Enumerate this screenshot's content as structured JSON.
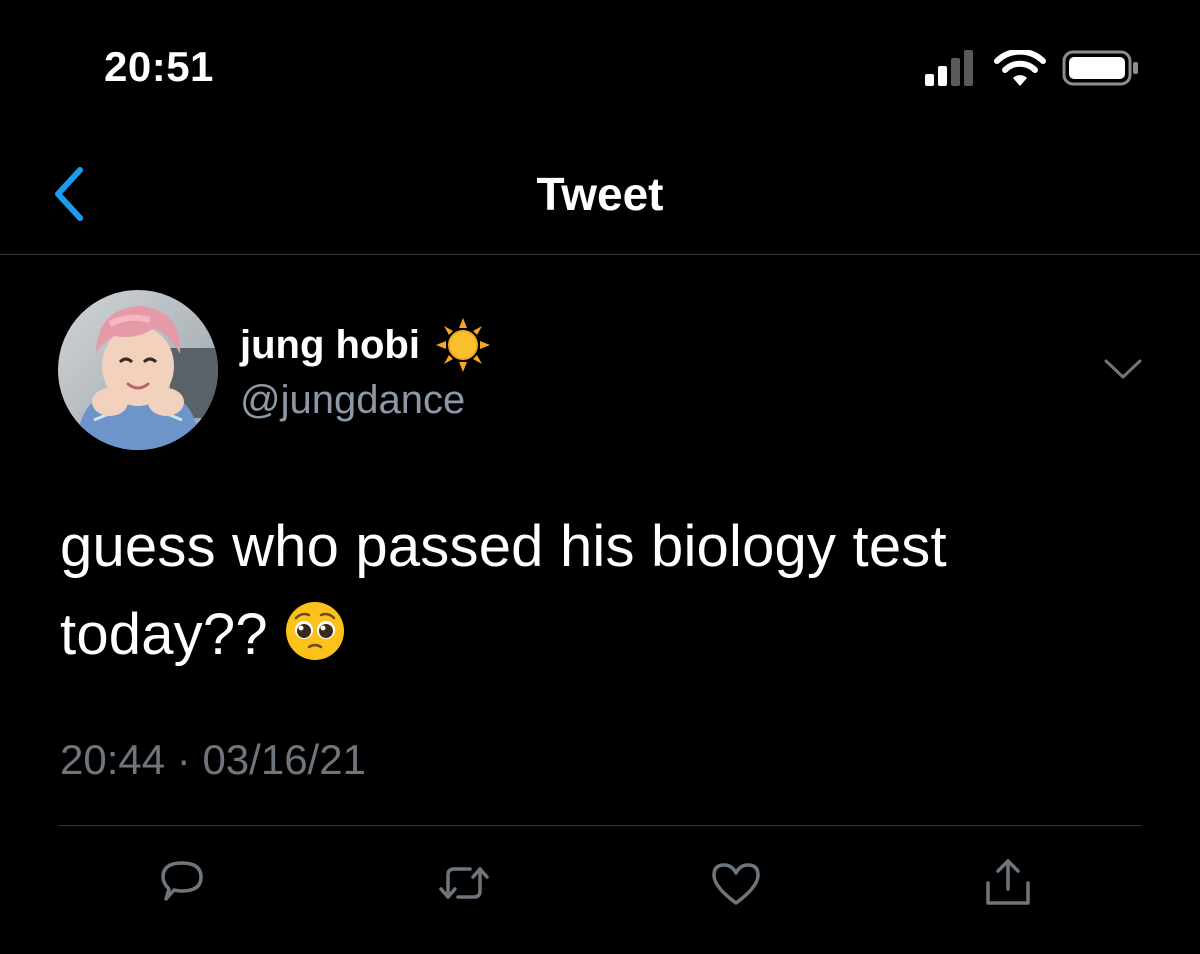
{
  "status_bar": {
    "time": "20:51",
    "icons": [
      "cellular-signal-icon",
      "wifi-icon",
      "battery-icon"
    ]
  },
  "nav": {
    "back_icon": "chevron-left-icon",
    "title": "Tweet"
  },
  "tweet": {
    "author": {
      "name": "jung hobi",
      "name_emoji": "sun-emoji",
      "handle": "@jungdance"
    },
    "text_line1": "guess who passed his biology test",
    "text_line2": "today??",
    "text_emoji": "pleading-face-emoji",
    "time": "20:44",
    "separator": "·",
    "date": "03/16/21",
    "actions": [
      "reply-icon",
      "retweet-icon",
      "like-icon",
      "share-icon"
    ]
  },
  "colors": {
    "background": "#000000",
    "text_primary": "#ffffff",
    "text_secondary": "#8b98a5",
    "text_meta": "#6e767d",
    "accent": "#1d9bf0",
    "divider": "#2f3336"
  }
}
